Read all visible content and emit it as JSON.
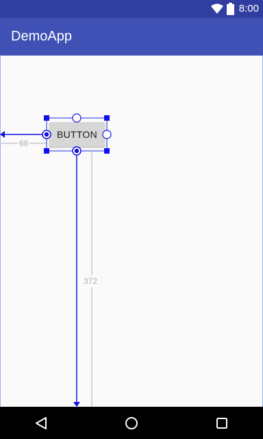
{
  "status_bar": {
    "time": "8:00",
    "icons": [
      "wifi-icon",
      "battery-icon"
    ]
  },
  "app_bar": {
    "title": "DemoApp"
  },
  "layout_editor": {
    "button_label": "BUTTON",
    "margin_left_value": "68",
    "margin_top_value": "372"
  },
  "nav_bar": {
    "buttons": [
      "back-icon",
      "home-icon",
      "recents-icon"
    ]
  },
  "colors": {
    "status_bar": "#303f9f",
    "app_bar": "#3f51b5",
    "selection": "#0000ff"
  }
}
